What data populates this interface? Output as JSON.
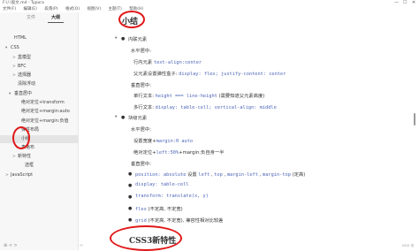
{
  "window": {
    "title": "F:\\八股文.md - Typora",
    "min": "—",
    "max": "☐",
    "close": "✕"
  },
  "menu": [
    "文件(F)",
    "编辑(E)",
    "段落(P)",
    "格式(O)",
    "视图(V)",
    "主题(T)",
    "帮助(H)"
  ],
  "sidebar": {
    "tabs": [
      "文件",
      "大纲"
    ],
    "outline": [
      {
        "label": "HTML",
        "arrow": ""
      },
      {
        "label": "CSS",
        "arrow": "▾"
      },
      {
        "label": "盒模型",
        "arrow": ">"
      },
      {
        "label": "BFC",
        "arrow": ">"
      },
      {
        "label": "选择器",
        "arrow": ">"
      },
      {
        "label": "清除浮动",
        "arrow": ""
      },
      {
        "label": "垂直居中",
        "arrow": "▾"
      },
      {
        "label": "绝对定位+transform",
        "arrow": ""
      },
      {
        "label": "绝对定位+margin:auto",
        "arrow": ""
      },
      {
        "label": "绝对定位+margin:负值",
        "arrow": ""
      },
      {
        "label": "弹性布局",
        "arrow": ""
      },
      {
        "label": "小结",
        "arrow": ""
      },
      {
        "label": "表格布",
        "arrow": ""
      },
      {
        "label": "新特性",
        "arrow": ">"
      },
      {
        "label": "选框",
        "arrow": ""
      },
      {
        "label": "JavaScript",
        "arrow": ">"
      }
    ]
  },
  "doc": {
    "heading": "小结",
    "l1": "内联元素",
    "l2": "水平居中:",
    "l3": "行内元素",
    "l3c": "text-align:center",
    "l4": "父元素设置弹性盒子:",
    "l4c": "display: flex; justify-content: center",
    "l5": "垂直居中:",
    "l6a": "单行文本:",
    "l6c": "height === line-height",
    "l6b": "(需要知道父元素高度)",
    "l7a": "多行文本:",
    "l7c": "display: table-cell; vertical-align: middle",
    "l8": "块级元素",
    "l9": "水平居中:",
    "l10a": "设置宽度+",
    "l10c": "margin:0 auto",
    "l11a": "绝对定位+",
    "l11c": "left:50%",
    "l11b": "+margin:负自身一半",
    "l12": "垂直居中:",
    "l13c1": "position: absolute",
    "l13a": " 设置 ",
    "l13c2": "left",
    "l13b": " , ",
    "l13c3": "top",
    "l13d": " , ",
    "l13c4": "margin-left",
    "l13e": " , ",
    "l13c5": "margin-top",
    "l13f": " (定高)",
    "l14c": "display: table-cell",
    "l15c": "transform: translate(x, y)",
    "l16c": "flex",
    "l16a": " (不定高, 不定宽)",
    "l17c": "grid",
    "l17a": " (不定高, 不定宽), 兼容性相对比较差",
    "heading2": "CSS3新特性"
  },
  "status": {
    "words": "4910 词"
  },
  "colors": {
    "code": "#4a63b6",
    "annotation": "#e01818"
  }
}
